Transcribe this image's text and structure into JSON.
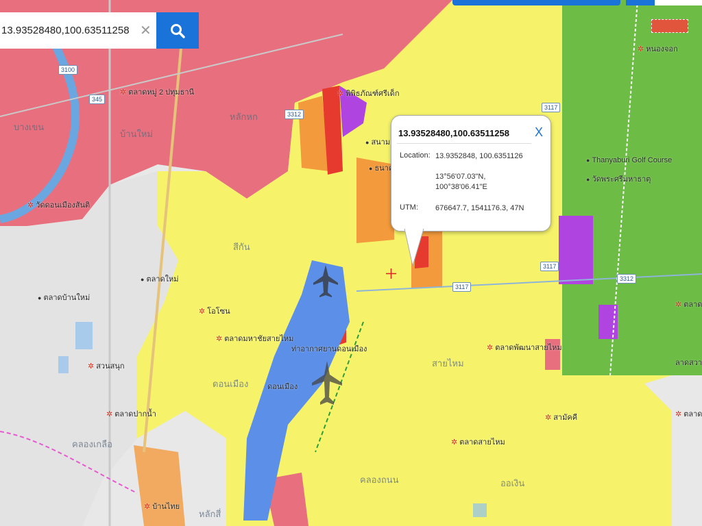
{
  "search": {
    "value": "13.93528480,100.63511258",
    "clear_icon": "close-icon",
    "button_icon": "search-icon"
  },
  "popup": {
    "title": "13.93528480,100.63511258",
    "close_label": "X",
    "location_label": "Location:",
    "location_value": "13.9352848, 100.6351126",
    "dms_lat": "13°56'07.03\"N,",
    "dms_lon": "100°38'06.41\"E",
    "utm_label": "UTM:",
    "utm_value": "676647.7, 1541176.3, 47N"
  },
  "map": {
    "area_labels": [
      "บางเขน",
      "บ้านใหม่",
      "หลักหก",
      "สีกัน",
      "สายไหม",
      "คลองถนน",
      "ออเงิน",
      "คลองเกลือ",
      "ดอนเมือง",
      "หลักสี่"
    ],
    "place_labels": [
      "ตลาดหมู่ 2 ปทุมธานี",
      "วัดดอนเมืองสันติ",
      "พิพิธภัณฑ์ศรีเด็ก",
      "โอโซน",
      "ตลาดมหาชัยสายไหม",
      "ตลาดพัฒนาสายไหม",
      "ตลาดสายไหม",
      "สนามกอล์ฟ",
      "ธนาคาร",
      "ท่าอากาศยานดอนเมือง",
      "ดอนเมือง",
      "สวนสนุก",
      "ตลาดปากน้ำ",
      "ตลาดบ้านใหม่",
      "ตลาดใหม่",
      "Thanyaburi Golf Course",
      "วัดพระศรีมหาธาตุ",
      "หนองจอก",
      "ลาดสวาย",
      "บ้านไทย",
      "สามัคคี",
      "ตลาดคลองสาม",
      "ตลาดคลองถนน"
    ],
    "road_tags": [
      "3100",
      "345",
      "3312",
      "3117",
      "3117",
      "3312",
      "3117"
    ],
    "colors": {
      "residential_pink": "#e8707e",
      "yellow_zone": "#f6f36a",
      "green_zone": "#6cbc45",
      "orange_zone": "#f39a3c",
      "red_zone": "#e63a2e",
      "purple_zone": "#b044e0",
      "runway_blue": "#5b8fe8",
      "urban_grey": "#e8e8e8",
      "river": "#6aa6e0",
      "search_button": "#1a73d9"
    }
  }
}
